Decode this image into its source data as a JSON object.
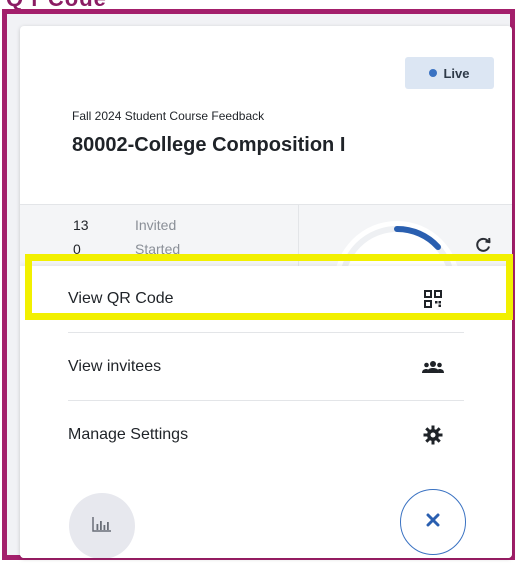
{
  "header_partial_text": "Q r Code",
  "survey": {
    "status": "Live",
    "term_label": "Fall 2024 Student Course Feedback",
    "course_title": "80002-College Composition I"
  },
  "stats": [
    {
      "value": "13",
      "label": "Invited"
    },
    {
      "value": "0",
      "label": "Started"
    }
  ],
  "menu": {
    "items": [
      {
        "label": "View QR Code",
        "icon": "qr-code-icon"
      },
      {
        "label": "View invitees",
        "icon": "users-icon"
      },
      {
        "label": "Manage Settings",
        "icon": "gear-icon"
      }
    ]
  },
  "icons": {
    "refresh": "refresh-icon",
    "chart": "bar-chart-icon",
    "close": "close-icon"
  },
  "colors": {
    "frame": "#a31f6b",
    "accent": "#3a72c2",
    "highlight": "#f2f000",
    "live_badge_bg": "#dce6f3"
  }
}
